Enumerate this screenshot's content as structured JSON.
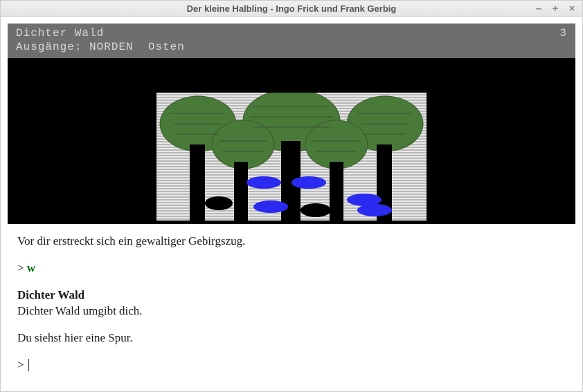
{
  "window": {
    "title": "Der kleine Halbling - Ingo Frick und Frank Gerbig"
  },
  "status": {
    "room": "Dichter Wald",
    "score": "3",
    "exits_label": "Ausgänge:",
    "exit_primary": "NORDEN",
    "exit_secondary": "Osten"
  },
  "narrative": {
    "intro": "Vor dir erstreckt sich ein gewaltiger Gebirgszug.",
    "prev_prompt": ">",
    "prev_command": "w",
    "room_title": "Dichter Wald",
    "room_desc": "Dichter Wald umgibt dich.",
    "observation": "Du siehst hier eine Spur.",
    "prompt": ">"
  }
}
